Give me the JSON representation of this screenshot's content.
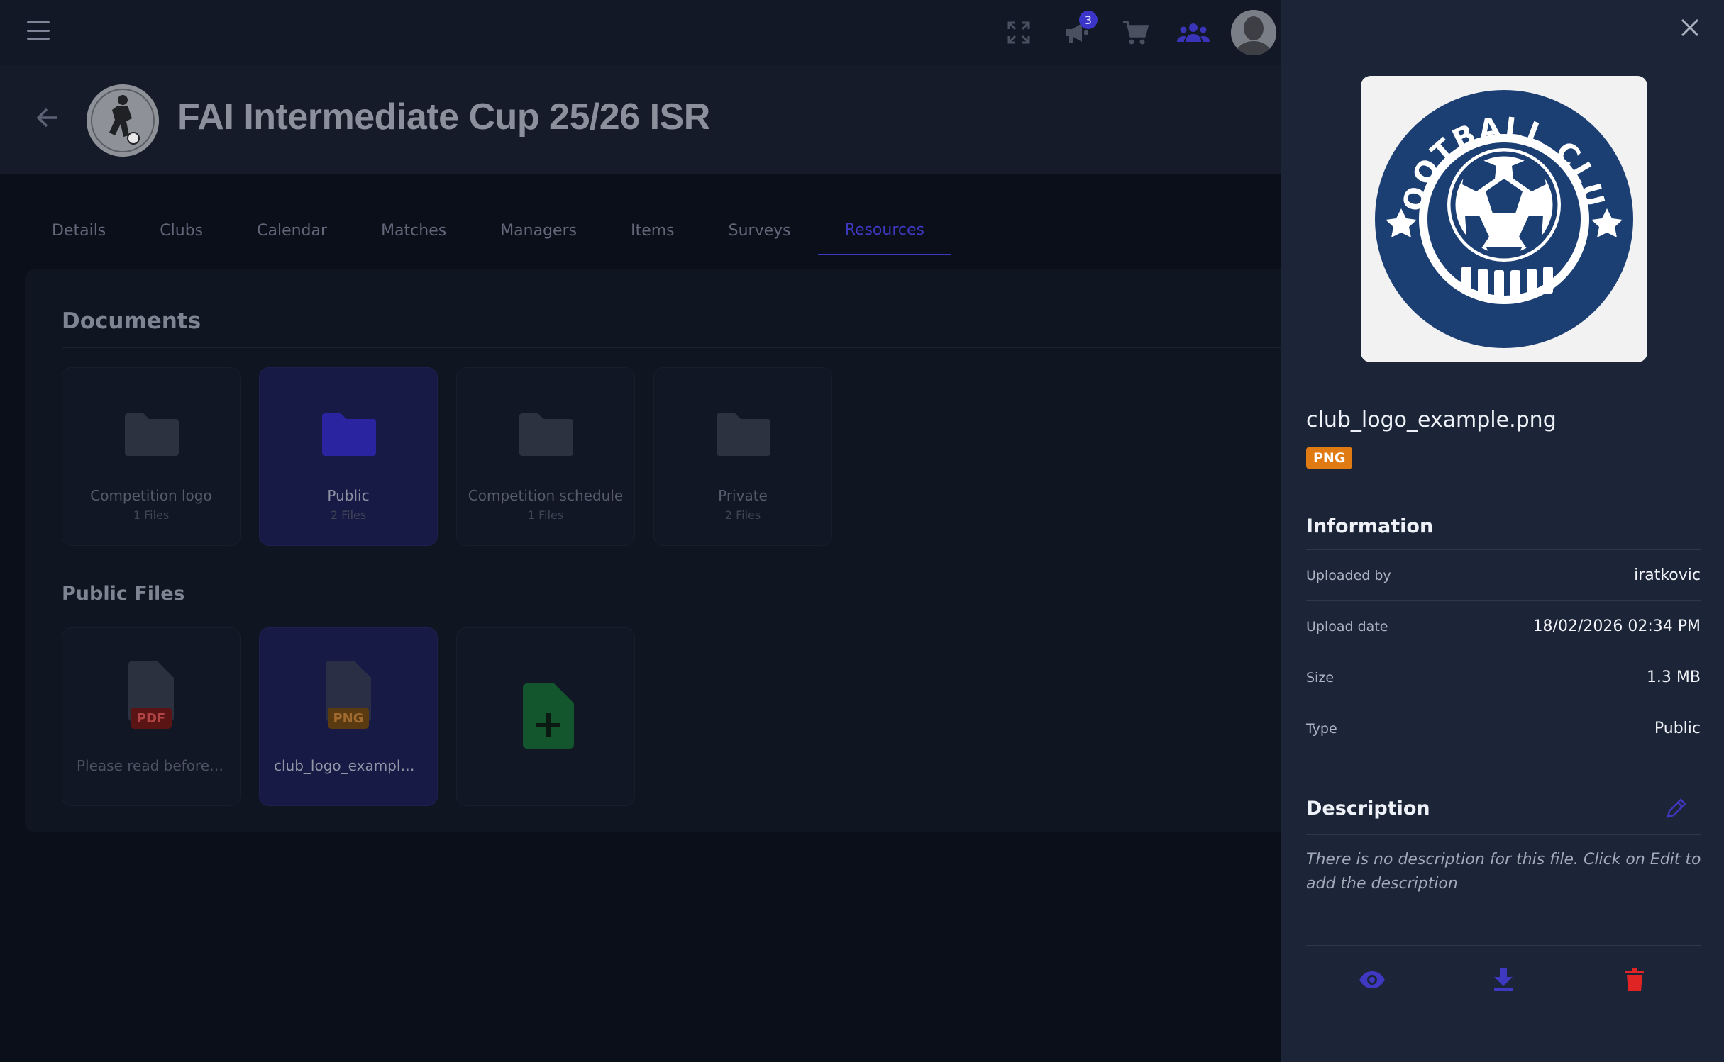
{
  "app": {
    "notification_count": "3",
    "icons": [
      "menu-icon",
      "fullscreen-icon",
      "megaphone-icon",
      "cart-icon",
      "groups-icon",
      "avatar"
    ]
  },
  "header": {
    "title": "FAI Intermediate Cup 25/26 ISR"
  },
  "tabs": [
    {
      "label": "Details"
    },
    {
      "label": "Clubs"
    },
    {
      "label": "Calendar"
    },
    {
      "label": "Matches"
    },
    {
      "label": "Managers"
    },
    {
      "label": "Items"
    },
    {
      "label": "Surveys"
    },
    {
      "label": "Resources",
      "active": true
    }
  ],
  "documents": {
    "title": "Documents",
    "folders": [
      {
        "name": "Competition logo",
        "count": "1 Files"
      },
      {
        "name": "Public",
        "count": "2 Files",
        "selected": true
      },
      {
        "name": "Competition schedule",
        "count": "1 Files"
      },
      {
        "name": "Private",
        "count": "2 Files"
      }
    ]
  },
  "public_files": {
    "title": "Public Files",
    "files": [
      {
        "tag": "PDF",
        "name": "Please read before ..."
      },
      {
        "tag": "PNG",
        "name": "club_logo_example....",
        "selected": true
      }
    ]
  },
  "drawer": {
    "file_name": "club_logo_example.png",
    "file_type": "PNG",
    "preview_logo_text": "FOOTBALL CLUB",
    "information": {
      "title": "Information",
      "rows": [
        {
          "label": "Uploaded by",
          "value": "iratkovic"
        },
        {
          "label": "Upload date",
          "value": "18/02/2026 02:34 PM"
        },
        {
          "label": "Size",
          "value": "1.3 MB"
        },
        {
          "label": "Type",
          "value": "Public"
        }
      ]
    },
    "description": {
      "title": "Description",
      "text": "There is no description for this file. Click on Edit to add the description"
    }
  },
  "colors": {
    "accent": "#3f38c0",
    "png_tag": "#e07a12",
    "delete": "#e02424",
    "drawer_bg": "#1c2437"
  }
}
